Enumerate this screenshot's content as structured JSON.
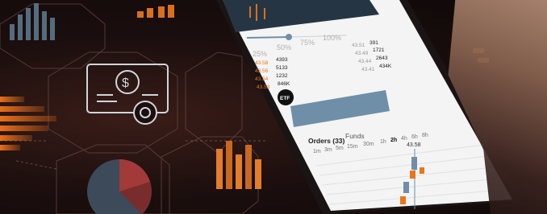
{
  "slider_ticks": [
    "25%",
    "50%",
    "75%",
    "100%"
  ],
  "left_prices": [
    "43.58",
    "43.56",
    "43.54",
    "43.53"
  ],
  "left_sizes": [
    "4393",
    "5133",
    "1232",
    "846K"
  ],
  "right_prices": [
    "43.51",
    "43.49",
    "43.44",
    "43.41"
  ],
  "right_sizes": [
    "391",
    "1721",
    "2643",
    "434K"
  ],
  "etf_badge": "ETF",
  "tabs": {
    "orders": "Orders (33)",
    "funds": "Funds"
  },
  "intervals": [
    "1m",
    "3m",
    "5m",
    "15m",
    "30m",
    "1h",
    "2h",
    "4h",
    "6h",
    "8h"
  ],
  "candle_label": "43.58",
  "colors": {
    "accent": "#e8761c",
    "bar": "#6e8fa7",
    "screen": "#f4f4f4",
    "dark": "#160c0b"
  }
}
